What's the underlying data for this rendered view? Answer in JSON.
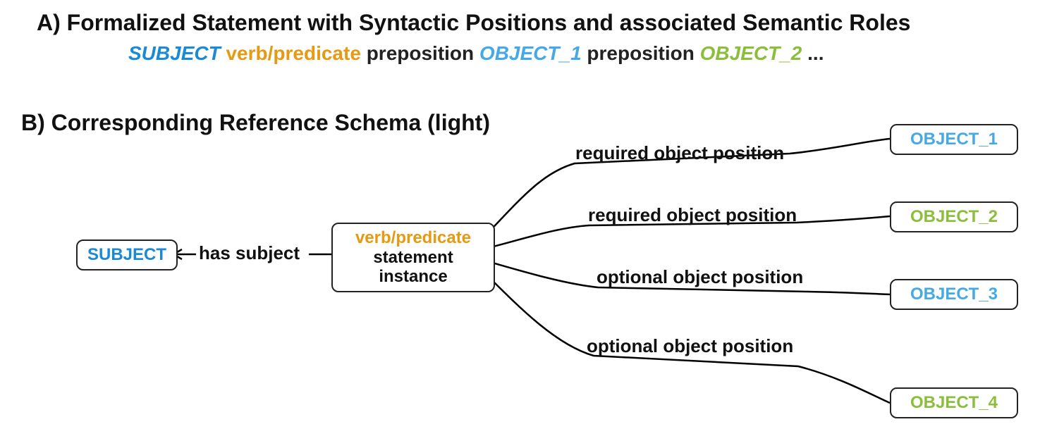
{
  "section_a": {
    "heading": "A) Formalized Statement with Syntactic Positions and associated Semantic Roles",
    "tokens": {
      "subject": "SUBJECT",
      "verb": "verb/predicate",
      "preposition": "preposition",
      "object1": "OBJECT_1",
      "object2": "OBJECT_2",
      "ellipsis": "..."
    }
  },
  "section_b": {
    "heading": "B) Corresponding Reference Schema (light)",
    "nodes": {
      "subject": "SUBJECT",
      "center_verb": "verb/predicate",
      "center_rest": "statement\ninstance",
      "obj1": "OBJECT_1",
      "obj2": "OBJECT_2",
      "obj3": "OBJECT_3",
      "obj4": "OBJECT_4"
    },
    "edges": {
      "left": "has subject",
      "e1": "required object position",
      "e2": "required object position",
      "e3": "optional object position",
      "e4": "optional object position"
    }
  },
  "colors": {
    "subject": "#1b8ad4",
    "verb": "#e69a12",
    "obj_blue": "#45a9e6",
    "obj_green": "#8bbf3b",
    "text": "#111111"
  }
}
